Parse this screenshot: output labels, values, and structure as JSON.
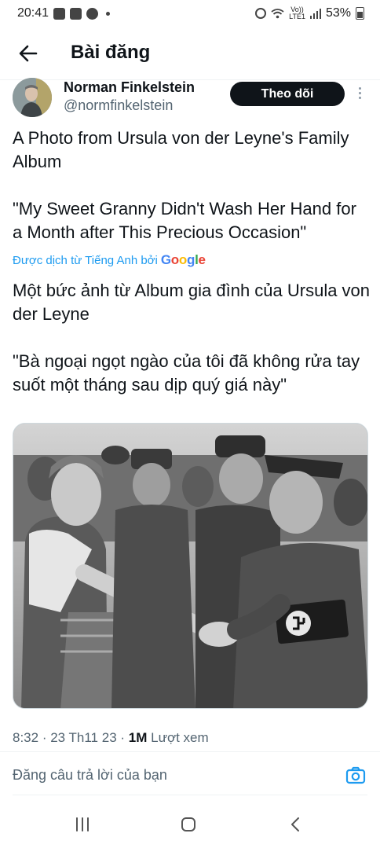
{
  "status_bar": {
    "time": "20:41",
    "network_label_top": "Vo))",
    "network_label_bottom": "LTE1",
    "battery": "53%"
  },
  "header": {
    "title": "Bài đăng"
  },
  "author": {
    "name": "Norman Finkelstein",
    "handle": "@normfinkelstein",
    "follow_label": "Theo dõi"
  },
  "tweet": {
    "original_text": "A Photo from Ursula von der Leyne's Family Album\n\n\"My Sweet Granny Didn't Wash Her Hand for a Month after This Precious Occasion\"",
    "translated_by_label": "Được dịch từ Tiếng Anh bởi",
    "translator_brand": "Google",
    "translated_text": "Một bức ảnh từ Album gia đình của Ursula von der Leyne\n\n\"Bà ngoại ngọt ngào của tôi đã không rửa tay suốt một tháng sau dịp quý giá này\""
  },
  "meta": {
    "time": "8:32",
    "separator": " · ",
    "date": "23 Th11 23",
    "views_count": "1M",
    "views_label": "Lượt xem"
  },
  "reply": {
    "placeholder": "Đăng câu trả lời của bạn"
  },
  "icons": {
    "back": "arrow-left-icon",
    "more": "more-vertical-icon",
    "camera": "camera-icon"
  },
  "colors": {
    "follow_bg": "#0f1419",
    "link": "#1d9bf0",
    "secondary_text": "#536471"
  }
}
